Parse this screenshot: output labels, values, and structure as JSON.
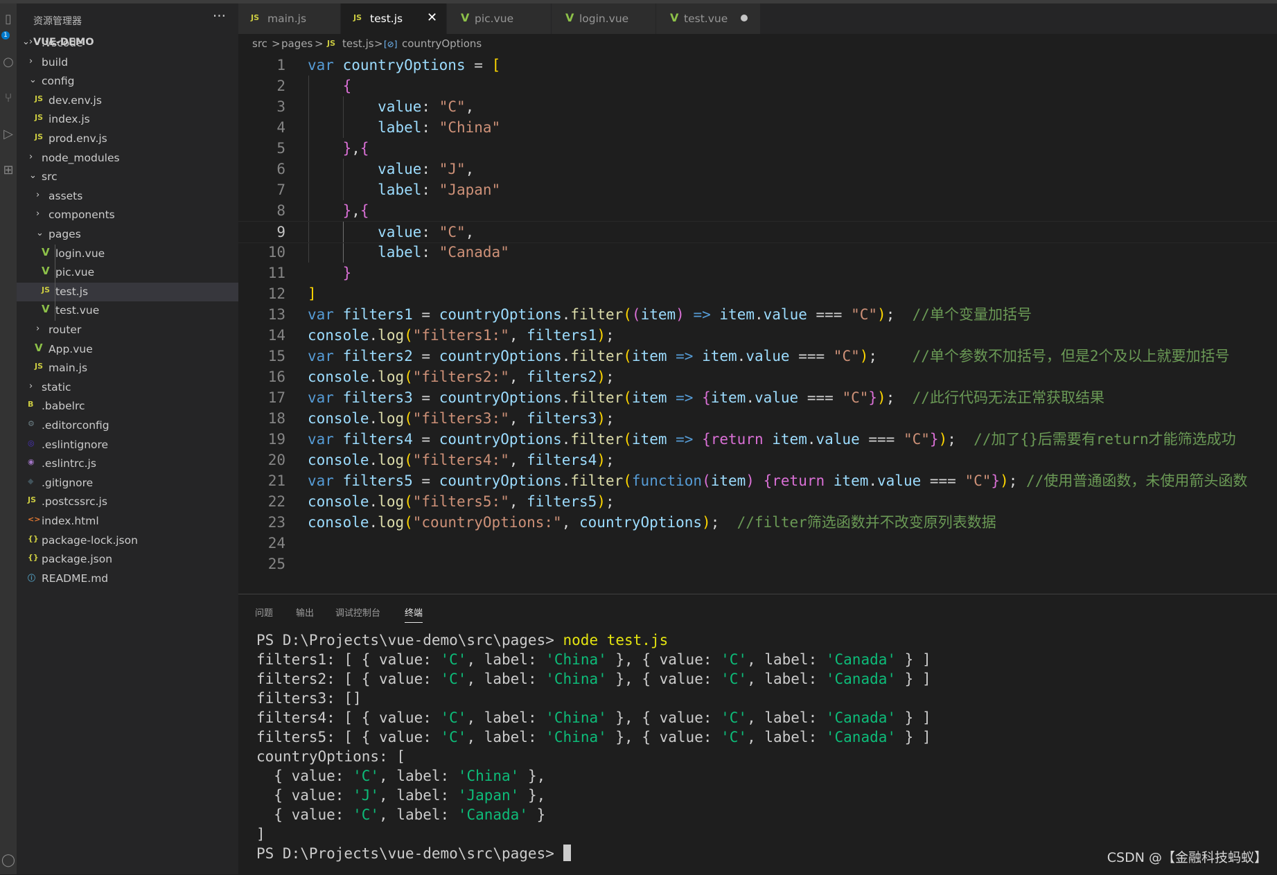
{
  "sidebar": {
    "title": "资源管理器",
    "more": "···",
    "root": "VUE-DEMO",
    "items": [
      {
        "label": ".vscode",
        "type": "folder",
        "chev": "›",
        "icon": "",
        "icon_color": ""
      },
      {
        "label": "build",
        "type": "folder",
        "chev": "›",
        "icon": "",
        "icon_color": ""
      },
      {
        "label": "config",
        "type": "folder",
        "chev": "⌄",
        "icon": "",
        "icon_color": ""
      },
      {
        "label": "dev.env.js",
        "type": "js",
        "chev": "",
        "icon": "JS",
        "icon_color": "#cbcb41"
      },
      {
        "label": "index.js",
        "type": "js",
        "chev": "",
        "icon": "JS",
        "icon_color": "#cbcb41"
      },
      {
        "label": "prod.env.js",
        "type": "js",
        "chev": "",
        "icon": "JS",
        "icon_color": "#cbcb41"
      },
      {
        "label": "node_modules",
        "type": "folder",
        "chev": "›",
        "icon": "",
        "icon_color": ""
      },
      {
        "label": "src",
        "type": "folder",
        "chev": "⌄",
        "icon": "",
        "icon_color": ""
      },
      {
        "label": "assets",
        "type": "folder",
        "chev": "›",
        "icon": "",
        "icon_color": ""
      },
      {
        "label": "components",
        "type": "folder",
        "chev": "›",
        "icon": "",
        "icon_color": ""
      },
      {
        "label": "pages",
        "type": "folder",
        "chev": "⌄",
        "icon": "",
        "icon_color": ""
      },
      {
        "label": "login.vue",
        "type": "vue",
        "chev": "",
        "icon": "V",
        "icon_color": "#8dc149"
      },
      {
        "label": "pic.vue",
        "type": "vue",
        "chev": "",
        "icon": "V",
        "icon_color": "#8dc149"
      },
      {
        "label": "test.js",
        "type": "js",
        "chev": "",
        "icon": "JS",
        "icon_color": "#cbcb41"
      },
      {
        "label": "test.vue",
        "type": "vue",
        "chev": "",
        "icon": "V",
        "icon_color": "#8dc149"
      },
      {
        "label": "router",
        "type": "folder",
        "chev": "›",
        "icon": "",
        "icon_color": ""
      },
      {
        "label": "App.vue",
        "type": "vue",
        "chev": "",
        "icon": "V",
        "icon_color": "#8dc149"
      },
      {
        "label": "main.js",
        "type": "js",
        "chev": "",
        "icon": "JS",
        "icon_color": "#cbcb41"
      },
      {
        "label": "static",
        "type": "folder",
        "chev": "›",
        "icon": "",
        "icon_color": ""
      },
      {
        "label": ".babelrc",
        "type": "babel",
        "chev": "",
        "icon": "B",
        "icon_color": "#cbcb41"
      },
      {
        "label": ".editorconfig",
        "type": "config",
        "chev": "",
        "icon": "⚙",
        "icon_color": "#6d8086"
      },
      {
        "label": ".eslintignore",
        "type": "eslint",
        "chev": "",
        "icon": "◎",
        "icon_color": "#4b32c3"
      },
      {
        "label": ".eslintrc.js",
        "type": "eslint",
        "chev": "",
        "icon": "◉",
        "icon_color": "#a074c4"
      },
      {
        "label": ".gitignore",
        "type": "git",
        "chev": "",
        "icon": "◆",
        "icon_color": "#41535b"
      },
      {
        "label": ".postcssrc.js",
        "type": "js",
        "chev": "",
        "icon": "JS",
        "icon_color": "#cbcb41"
      },
      {
        "label": "index.html",
        "type": "html",
        "chev": "",
        "icon": "<>",
        "icon_color": "#e37933"
      },
      {
        "label": "package-lock.json",
        "type": "json",
        "chev": "",
        "icon": "{}",
        "icon_color": "#cbcb41"
      },
      {
        "label": "package.json",
        "type": "json",
        "chev": "",
        "icon": "{}",
        "icon_color": "#cbcb41"
      },
      {
        "label": "README.md",
        "type": "md",
        "chev": "",
        "icon": "ⓘ",
        "icon_color": "#519aba"
      }
    ]
  },
  "tabs": [
    {
      "label": "main.js",
      "icon": "JS",
      "icon_color": "#cbcb41"
    },
    {
      "label": "test.js",
      "icon": "JS",
      "icon_color": "#cbcb41",
      "close": "✕"
    },
    {
      "label": "pic.vue",
      "icon": "V",
      "icon_color": "#8dc149"
    },
    {
      "label": "login.vue",
      "icon": "V",
      "icon_color": "#8dc149"
    },
    {
      "label": "test.vue",
      "icon": "V",
      "icon_color": "#8dc149"
    }
  ],
  "breadcrumb": [
    "src",
    ">",
    "pages",
    ">",
    "JS",
    "test.js",
    ">",
    "[⊘]",
    "countryOptions"
  ],
  "code": {
    "lines": [
      "1",
      "2",
      "3",
      "4",
      "5",
      "6",
      "7",
      "8",
      "9",
      "10",
      "11",
      "12",
      "13",
      "14",
      "15",
      "16",
      "17",
      "18",
      "19",
      "20",
      "21",
      "22",
      "23",
      "24",
      "25"
    ],
    "c13": "//单个变量加括号",
    "c15": "//单个参数不加括号，但是2个及以上就要加括号",
    "c17": "//此行代码无法正常获取结果",
    "c19": "//加了{}后需要有return才能筛选成功",
    "c21": "//使用普通函数，未使用箭头函数",
    "c23": "//filter筛选函数并不改变原列表数据"
  },
  "panel": {
    "tabs": [
      "问题",
      "输出",
      "调试控制台",
      "终端"
    ],
    "prompt": "PS D:\\Projects\\vue-demo\\src\\pages> ",
    "command": "node test.js"
  },
  "watermark": "CSDN @【金融科技蚂蚁】"
}
